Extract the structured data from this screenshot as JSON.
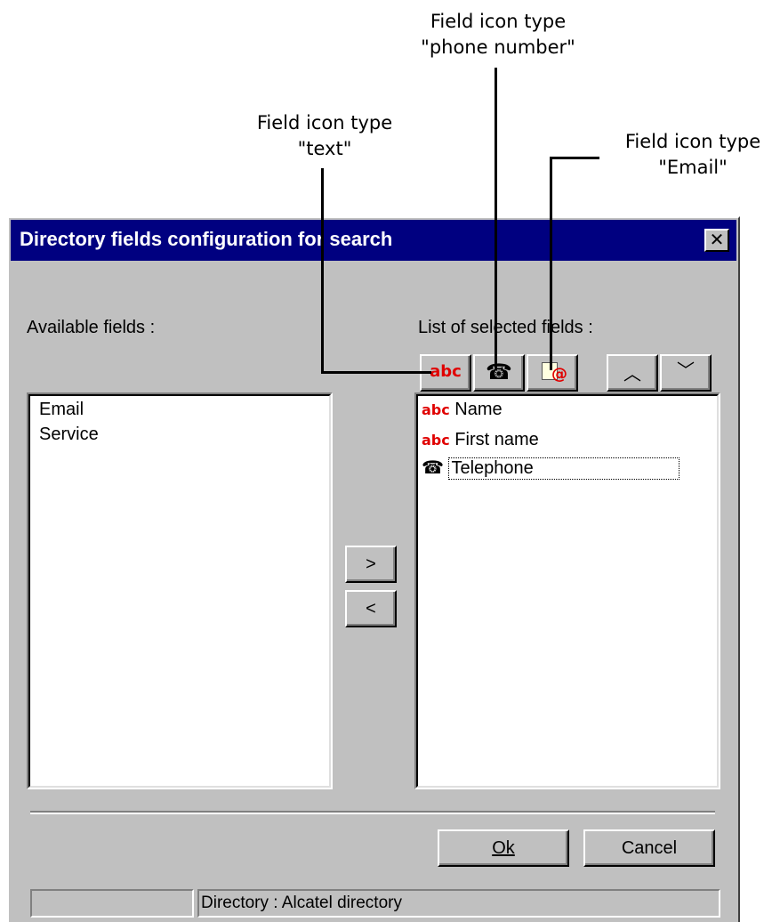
{
  "callouts": {
    "phone": [
      "Field icon type",
      "\"phone number\""
    ],
    "text": [
      "Field icon type",
      "\"text\""
    ],
    "email": [
      "Field icon type",
      "\"Email\""
    ]
  },
  "dialog": {
    "title": "Directory fields configuration for search",
    "close_glyph": "✕",
    "available_label": "Available fields :",
    "selected_label": "List of selected fields :",
    "available_fields": [
      "Email",
      "Service"
    ],
    "selected_fields": [
      {
        "icon": "text-type-icon",
        "glyph": "abc",
        "label": "Name"
      },
      {
        "icon": "text-type-icon",
        "glyph": "abc",
        "label": "First name"
      },
      {
        "icon": "phone-type-icon",
        "glyph": "☎",
        "label": "Telephone"
      }
    ],
    "toolbar": {
      "text_glyph": "abc",
      "phone_glyph": "☎",
      "email_glyph": "@",
      "up_glyph": "︿",
      "down_glyph": "﹀"
    },
    "move_right": ">",
    "move_left": "<",
    "ok_label": "Ok",
    "cancel_label": "Cancel",
    "status_left": "",
    "status_right": "Directory : Alcatel directory"
  }
}
